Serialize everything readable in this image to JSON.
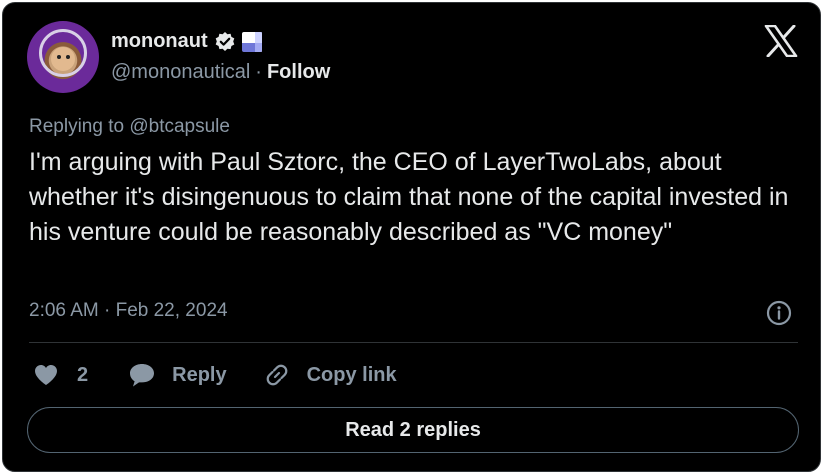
{
  "author": {
    "name": "mononaut",
    "handle": "@mononautical",
    "separator": "·",
    "follow_label": "Follow",
    "avatar_icon": "astronaut-monkey-avatar",
    "verified_icon": "verified-badge-icon",
    "flag_icon": "blue-white-flag-icon"
  },
  "brand": {
    "logo_icon": "x-logo-icon"
  },
  "tweet": {
    "reply_to": "Replying to @btcapsule",
    "text": "I'm arguing with Paul Sztorc, the CEO of LayerTwoLabs, about whether it's disingenuous to claim that none of the capital invested in his venture could be reasonably described as \"VC money\"",
    "timestamp": "2:06 AM · Feb 22, 2024",
    "info_icon": "info-icon"
  },
  "actions": {
    "like_count": "2",
    "like_icon": "heart-icon",
    "reply_label": "Reply",
    "reply_icon": "speech-bubble-icon",
    "copy_label": "Copy link",
    "copy_icon": "link-icon"
  },
  "footer": {
    "read_replies_label": "Read 2 replies"
  },
  "colors": {
    "background": "#000000",
    "text_primary": "#e7e9ea",
    "text_secondary": "#8b98a5",
    "border": "#2f3336"
  }
}
